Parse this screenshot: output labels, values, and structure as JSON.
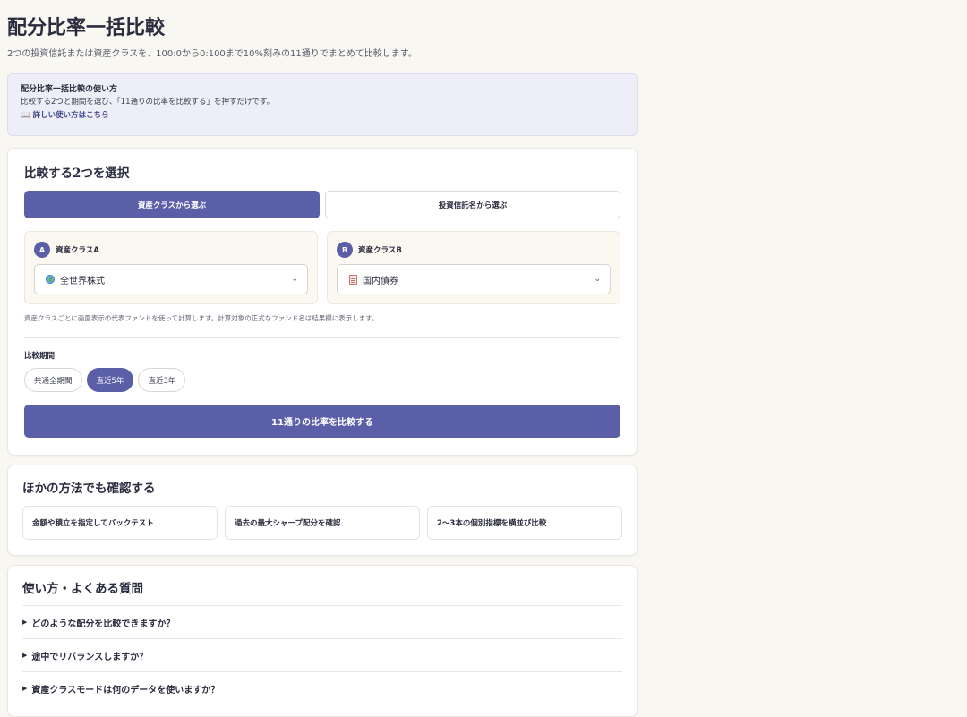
{
  "page": {
    "title": "配分比率一括比較",
    "description": "2つの投資信託または資産クラスを、100:0から0:100まで10%刻みの11通りでまとめて比較します。"
  },
  "help": {
    "title": "配分比率一括比較の使い方",
    "text": "比較する2つと期間を選び、「11通りの比率を比較する」を押すだけです。",
    "link": "詳しい使い方はこちら",
    "link_icon": "📖"
  },
  "selection": {
    "heading": "比較する2つを選択",
    "tabs": [
      {
        "label": "資産クラスから選ぶ",
        "active": true
      },
      {
        "label": "投資信託名から選ぶ",
        "active": false
      }
    ],
    "picker_a": {
      "badge": "A",
      "label": "資産クラスA",
      "value": "全世界株式",
      "icon": "globe-icon"
    },
    "picker_b": {
      "badge": "B",
      "label": "資産クラスB",
      "value": "国内債券",
      "icon": "document-icon"
    },
    "note": "資産クラスごとに画面表示の代表ファンドを使って計算します。計算対象の正式なファンド名は結果欄に表示します。",
    "period_label": "比較期間",
    "periods": [
      {
        "label": "共通全期間",
        "active": false
      },
      {
        "label": "直近5年",
        "active": true
      },
      {
        "label": "直近3年",
        "active": false
      }
    ],
    "compare_button": "11通りの比率を比較する"
  },
  "other_methods": {
    "heading": "ほかの方法でも確認する",
    "items": [
      "金額や積立を指定してバックテスト",
      "過去の最大シャープ配分を確認",
      "2〜3本の個別指標を横並び比較"
    ]
  },
  "faq": {
    "heading": "使い方・よくある質問",
    "items": [
      "どのような配分を比較できますか？",
      "途中でリバランスしますか？",
      "資産クラスモードは何のデータを使いますか？"
    ]
  },
  "colors": {
    "accent": "#5b5fa8",
    "background": "#f8f7f2",
    "help_bg": "#eeeef8"
  }
}
